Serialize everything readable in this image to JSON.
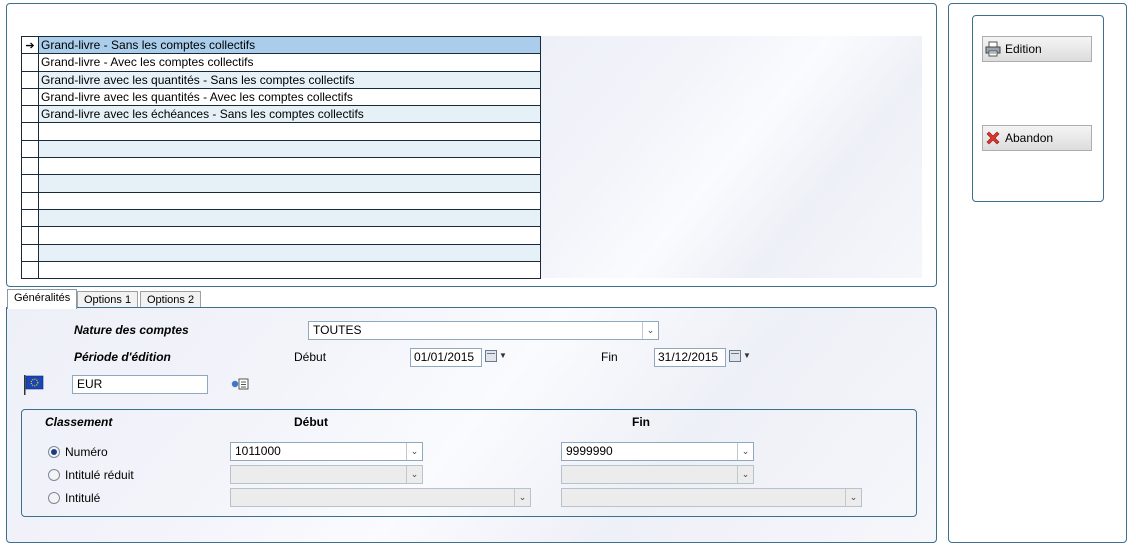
{
  "report_list": {
    "selected_indicator": "➔",
    "items": [
      "Grand-livre - Sans les comptes collectifs",
      "Grand-livre - Avec les comptes collectifs",
      "Grand-livre avec les quantités - Sans les comptes collectifs",
      "Grand-livre avec les quantités - Avec les comptes collectifs",
      "Grand-livre avec les échéances - Sans les comptes collectifs",
      "",
      "",
      "",
      "",
      "",
      "",
      "",
      "",
      ""
    ]
  },
  "actions": {
    "edition_label": "Edition",
    "abandon_label": "Abandon",
    "edition_icon": "printer-icon",
    "abandon_icon": "cancel-x-icon"
  },
  "tabs": [
    "Généralités",
    "Options 1",
    "Options 2"
  ],
  "form": {
    "nature_label": "Nature des comptes",
    "nature_value": "TOUTES",
    "periode_label": "Période d'édition",
    "debut_label": "Début",
    "debut_value": "01/01/2015",
    "fin_label": "Fin",
    "fin_value": "31/12/2015",
    "currency_value": "EUR",
    "currency_flag_icon": "eu-flag-icon",
    "currency_picker_icon": "currency-picker-icon"
  },
  "classement": {
    "title": "Classement",
    "debut_header": "Début",
    "fin_header": "Fin",
    "options": [
      {
        "label": "Numéro",
        "selected": true,
        "debut": "1011000",
        "fin": "9999990"
      },
      {
        "label": "Intitulé réduit",
        "selected": false,
        "debut": "",
        "fin": ""
      },
      {
        "label": "Intitulé",
        "selected": false,
        "debut": "",
        "fin": ""
      }
    ]
  },
  "colors": {
    "selected_row": "#a9cdea",
    "alt_row": "#e6f0f7",
    "panel_border": "#3f6f8f",
    "radio_dot": "#1b3a8a"
  }
}
